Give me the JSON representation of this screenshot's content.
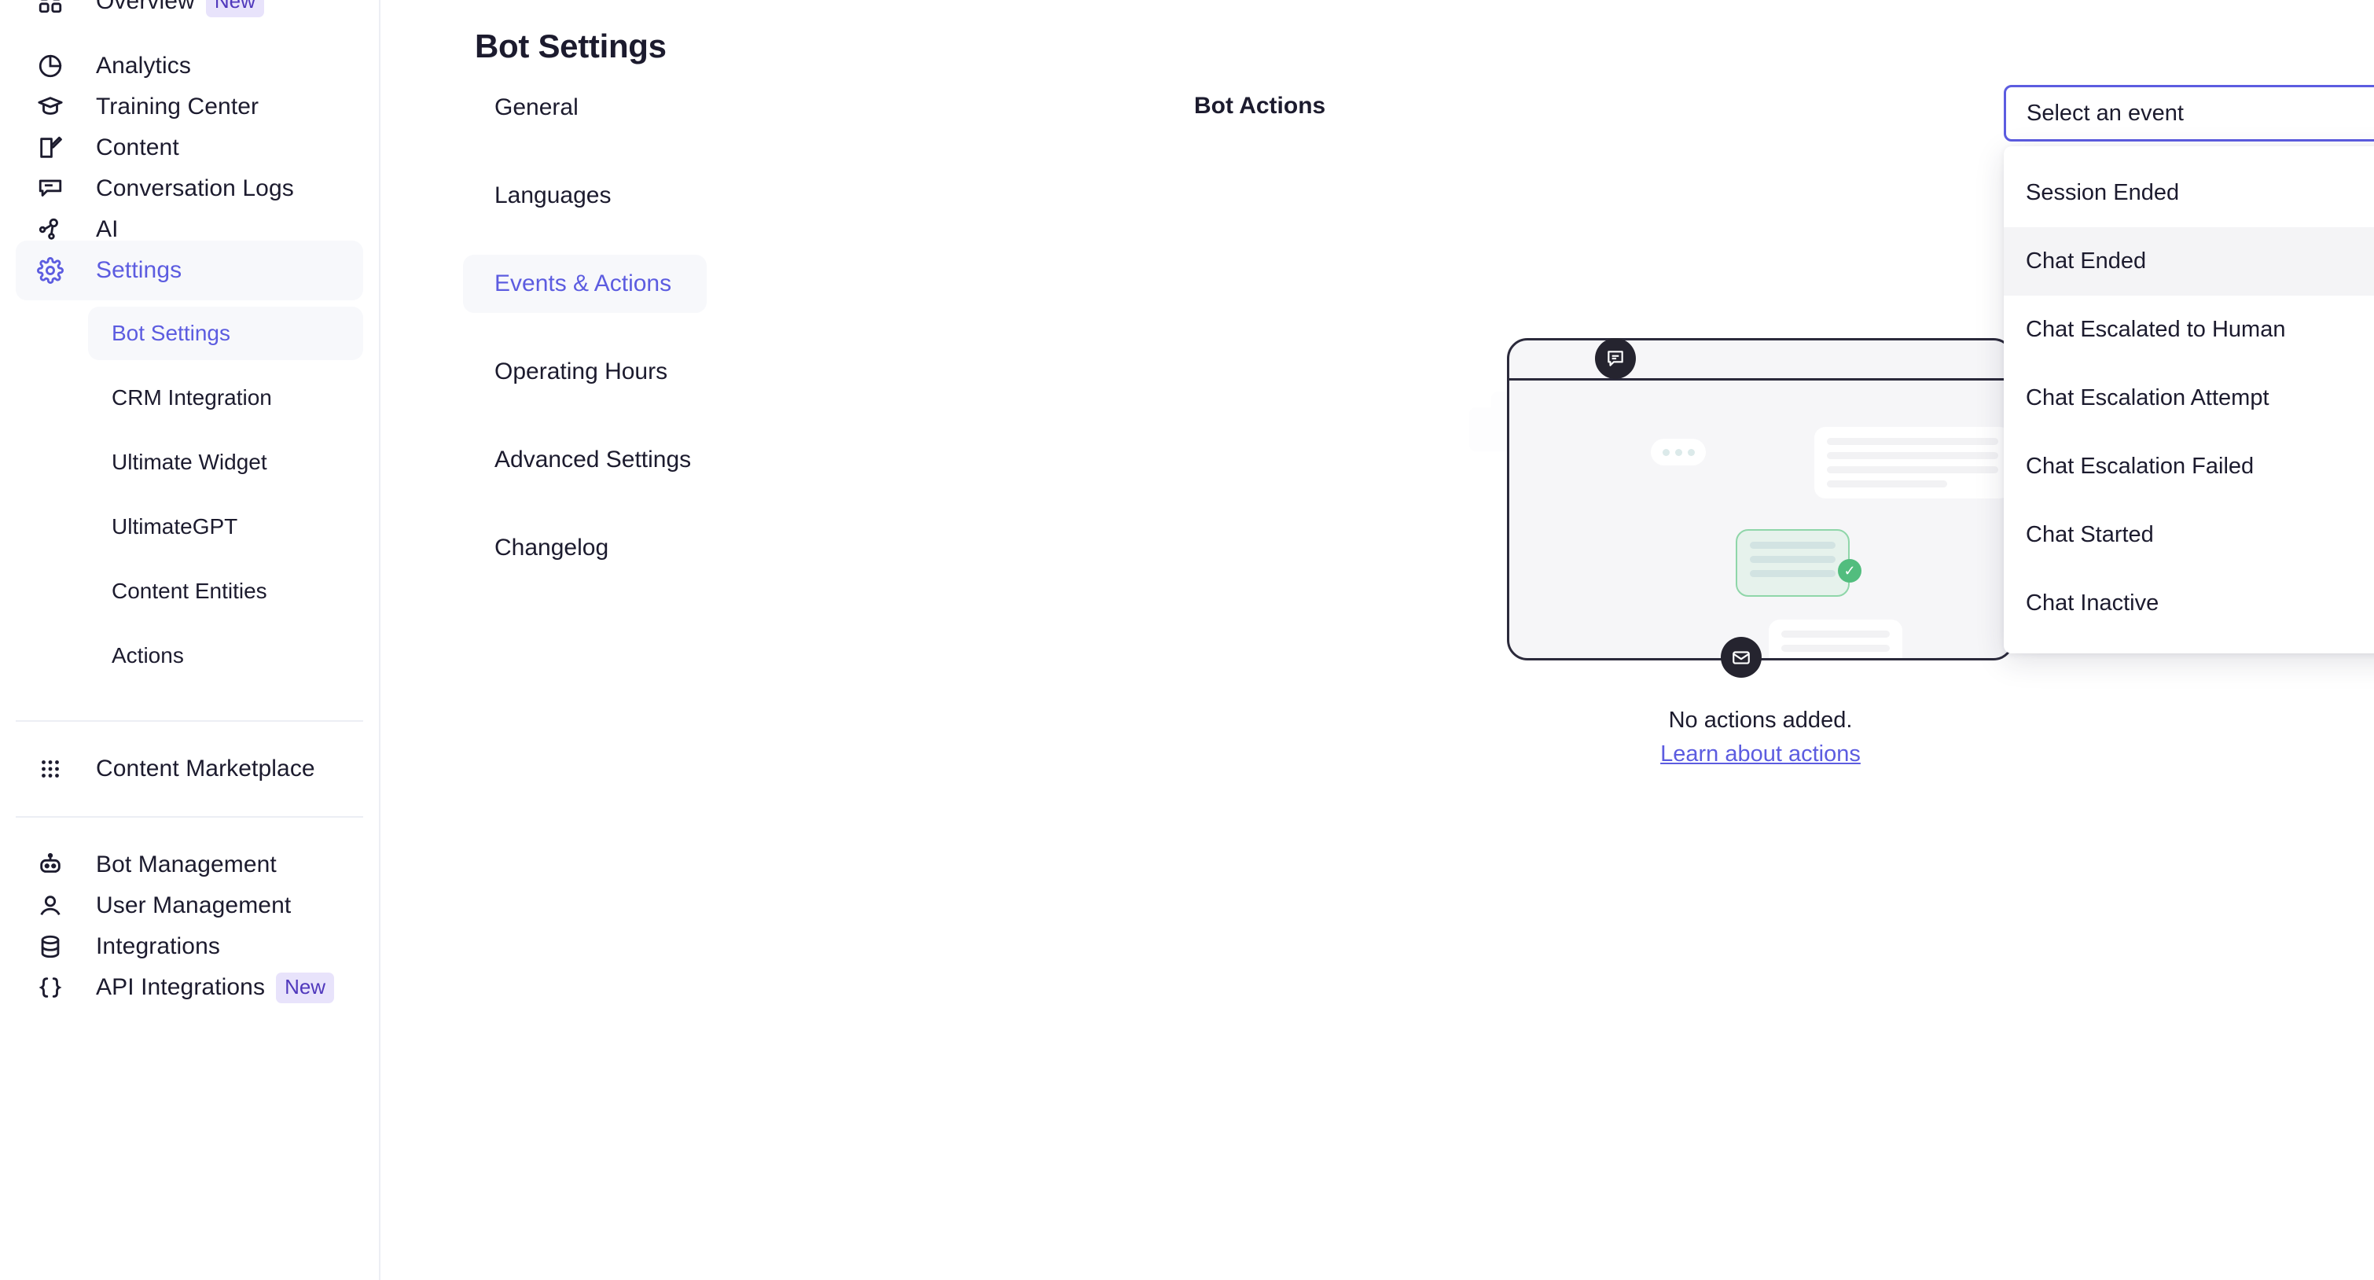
{
  "sidebar": {
    "items": [
      {
        "label": "Overview",
        "icon": "grid-icon",
        "badge": "New",
        "active": false,
        "partial_top": true
      },
      {
        "label": "Analytics",
        "icon": "pie-chart-icon",
        "badge": "",
        "active": false
      },
      {
        "label": "Training Center",
        "icon": "graduation-cap-icon",
        "badge": "",
        "active": false
      },
      {
        "label": "Content",
        "icon": "edit-square-icon",
        "badge": "",
        "active": false
      },
      {
        "label": "Conversation Logs",
        "icon": "chat-log-icon",
        "badge": "",
        "active": false
      },
      {
        "label": "AI",
        "icon": "ai-nodes-icon",
        "badge": "",
        "active": false
      },
      {
        "label": "Settings",
        "icon": "gear-icon",
        "badge": "",
        "active": true
      }
    ],
    "sub_items": [
      {
        "label": "Bot Settings",
        "active": true
      },
      {
        "label": "CRM Integration",
        "active": false
      },
      {
        "label": "Ultimate Widget",
        "active": false
      },
      {
        "label": "UltimateGPT",
        "active": false
      },
      {
        "label": "Content Entities",
        "active": false
      },
      {
        "label": "Actions",
        "active": false
      }
    ],
    "marketplace": {
      "label": "Content Marketplace",
      "icon": "dots-grid-icon"
    },
    "bottom_items": [
      {
        "label": "Bot Management",
        "icon": "robot-icon",
        "badge": ""
      },
      {
        "label": "User Management",
        "icon": "user-icon",
        "badge": ""
      },
      {
        "label": "Integrations",
        "icon": "database-icon",
        "badge": ""
      },
      {
        "label": "API Integrations",
        "icon": "code-braces-icon",
        "badge": "New"
      }
    ]
  },
  "page": {
    "title": "Bot Settings"
  },
  "settings_tabs": [
    {
      "label": "General",
      "active": false
    },
    {
      "label": "Languages",
      "active": false
    },
    {
      "label": "Events & Actions",
      "active": true
    },
    {
      "label": "Operating Hours",
      "active": false
    },
    {
      "label": "Advanced Settings",
      "active": false
    },
    {
      "label": "Changelog",
      "active": false
    }
  ],
  "content": {
    "heading": "Bot Actions",
    "empty_message": "No actions added.",
    "empty_link": "Learn about actions"
  },
  "event_select": {
    "value": "Select an event",
    "placeholder": "Select an event",
    "expanded": true,
    "close_label": "×",
    "options": [
      {
        "label": "Session Ended",
        "hovered": false
      },
      {
        "label": "Chat Ended",
        "hovered": true
      },
      {
        "label": "Chat Escalated to Human",
        "hovered": false
      },
      {
        "label": "Chat Escalation Attempt",
        "hovered": false
      },
      {
        "label": "Chat Escalation Failed",
        "hovered": false
      },
      {
        "label": "Chat Started",
        "hovered": false
      },
      {
        "label": "Chat Inactive",
        "hovered": false
      }
    ]
  },
  "colors": {
    "accent": "#5c5ce0",
    "badge_bg": "#e8e3fb",
    "badge_text": "#5038bc",
    "text": "#1c1b2e",
    "active_bg": "#f7f8fb",
    "border": "#eceef4",
    "success": "#52bd7e"
  }
}
